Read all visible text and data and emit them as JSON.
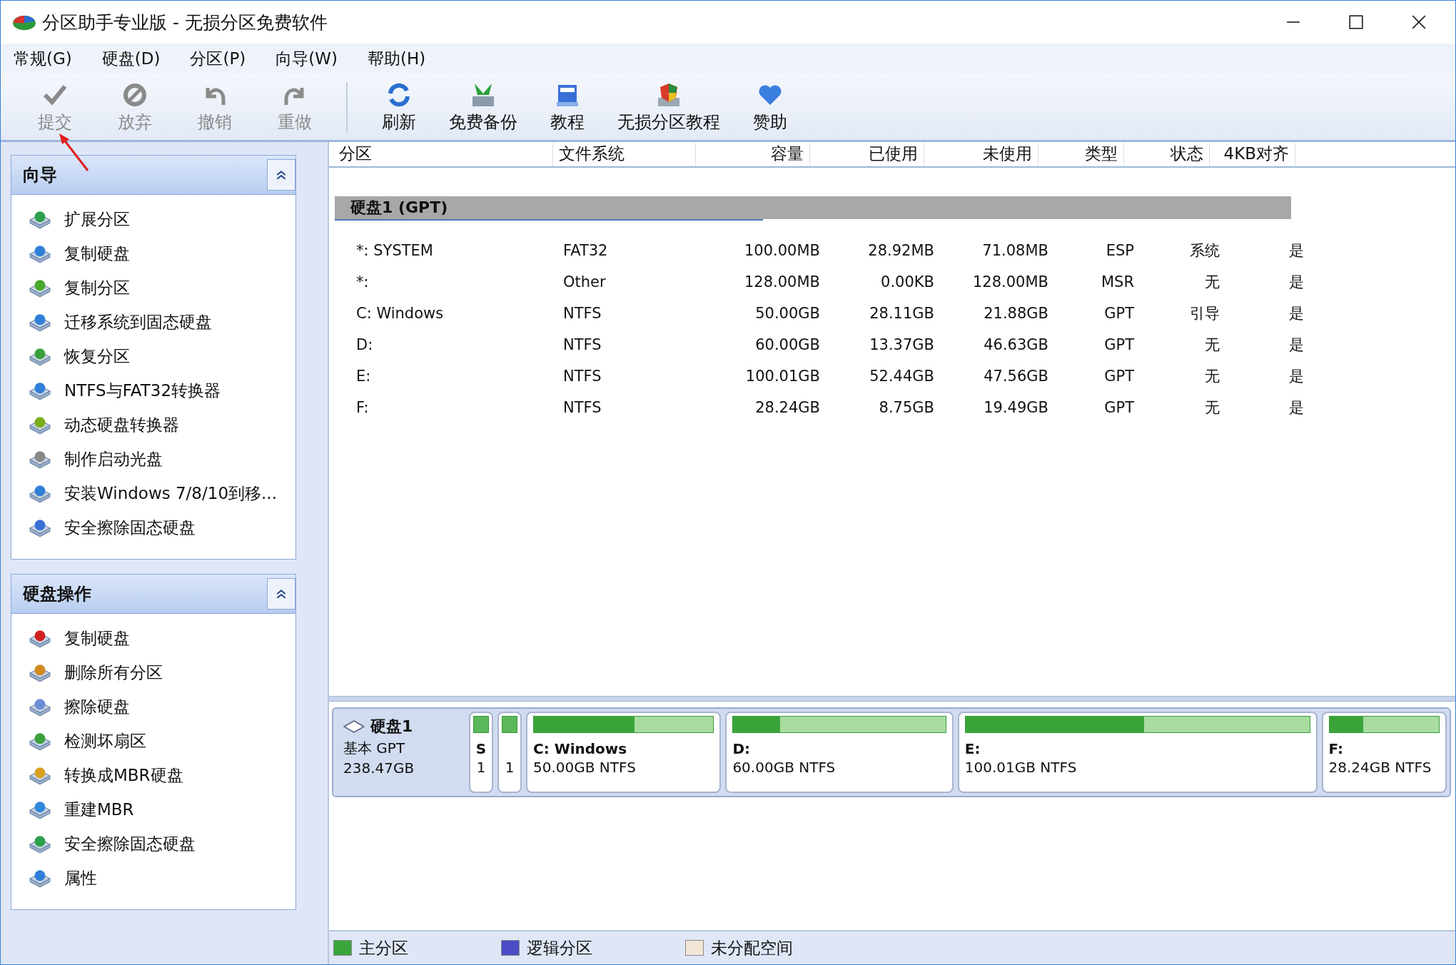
{
  "window": {
    "title": "分区助手专业版 - 无损分区免费软件"
  },
  "menu": [
    "常规(G)",
    "硬盘(D)",
    "分区(P)",
    "向导(W)",
    "帮助(H)"
  ],
  "toolbar": [
    {
      "label": "提交",
      "disabled": true
    },
    {
      "label": "放弃",
      "disabled": true
    },
    {
      "label": "撤销",
      "disabled": true
    },
    {
      "label": "重做",
      "disabled": true
    },
    {
      "label": "刷新",
      "disabled": false
    },
    {
      "label": "免费备份",
      "disabled": false
    },
    {
      "label": "教程",
      "disabled": false
    },
    {
      "label": "无损分区教程",
      "disabled": false
    },
    {
      "label": "赞助",
      "disabled": false
    }
  ],
  "sidebar": [
    {
      "title": "向导",
      "expanded": true,
      "items": [
        "扩展分区",
        "复制硬盘",
        "复制分区",
        "迁移系统到固态硬盘",
        "恢复分区",
        "NTFS与FAT32转换器",
        "动态硬盘转换器",
        "制作启动光盘",
        "安装Windows 7/8/10到移...",
        "安全擦除固态硬盘"
      ]
    },
    {
      "title": "硬盘操作",
      "expanded": true,
      "items": [
        "复制硬盘",
        "删除所有分区",
        "擦除硬盘",
        "检测坏扇区",
        "转换成MBR硬盘",
        "重建MBR",
        "安全擦除固态硬盘",
        "属性"
      ]
    }
  ],
  "table": {
    "columns": [
      "分区",
      "文件系统",
      "容量",
      "已使用",
      "未使用",
      "类型",
      "状态",
      "4KB对齐"
    ],
    "disk_heading": "硬盘1 (GPT)",
    "rows": [
      [
        "*: SYSTEM",
        "FAT32",
        "100.00MB",
        "28.92MB",
        "71.08MB",
        "ESP",
        "系统",
        "是"
      ],
      [
        "*:",
        "Other",
        "128.00MB",
        "0.00KB",
        "128.00MB",
        "MSR",
        "无",
        "是"
      ],
      [
        "C: Windows",
        "NTFS",
        "50.00GB",
        "28.11GB",
        "21.88GB",
        "GPT",
        "引导",
        "是"
      ],
      [
        "D:",
        "NTFS",
        "60.00GB",
        "13.37GB",
        "46.63GB",
        "GPT",
        "无",
        "是"
      ],
      [
        "E:",
        "NTFS",
        "100.01GB",
        "52.44GB",
        "47.56GB",
        "GPT",
        "无",
        "是"
      ],
      [
        "F:",
        "NTFS",
        "28.24GB",
        "8.75GB",
        "19.49GB",
        "GPT",
        "无",
        "是"
      ]
    ]
  },
  "disk_map": {
    "name": "硬盘1",
    "type": "基本 GPT",
    "size": "238.47GB",
    "partitions": [
      {
        "label": "S",
        "detail": "1"
      },
      {
        "detail": "1"
      },
      {
        "label": "C: Windows",
        "detail": "50.00GB NTFS",
        "level": 0.56
      },
      {
        "label": "D:",
        "detail": "60.00GB NTFS",
        "level": 0.22
      },
      {
        "label": "E:",
        "detail": "100.01GB NTFS",
        "level": 0.52
      },
      {
        "label": "F:",
        "detail": "28.24GB NTFS",
        "level": 0.31
      }
    ]
  },
  "legend": [
    {
      "label": "主分区",
      "color": "#3ba53b"
    },
    {
      "label": "逻辑分区",
      "color": "#4c4cc6"
    },
    {
      "label": "未分配空间",
      "color": "#f3e6d6"
    }
  ]
}
